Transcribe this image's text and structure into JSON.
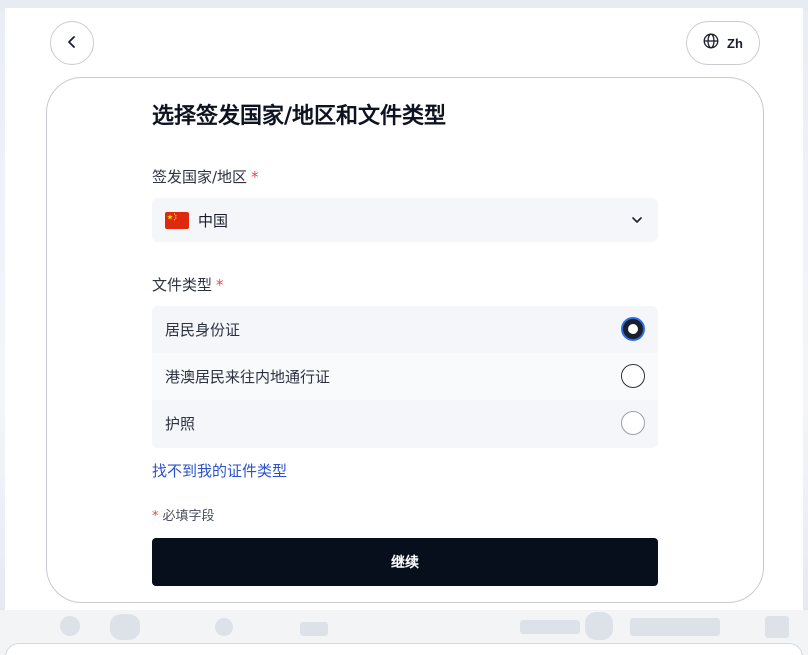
{
  "header": {
    "back_icon": "chevron-left-icon",
    "language": {
      "icon": "globe-icon",
      "label": "Zh"
    }
  },
  "form": {
    "title": "选择签发国家/地区和文件类型",
    "country": {
      "label": "签发国家/地区",
      "required_mark": "*",
      "selected_value": "中国",
      "flag_icon": "china-flag-icon",
      "dropdown_icon": "chevron-down-icon"
    },
    "document_type": {
      "label": "文件类型",
      "required_mark": "*",
      "options": [
        {
          "label": "居民身份证",
          "selected": true
        },
        {
          "label": "港澳居民来往内地通行证",
          "selected": false
        },
        {
          "label": "护照",
          "selected": false
        }
      ]
    },
    "help_link": "找不到我的证件类型",
    "required_note": {
      "mark": "*",
      "text": "必填字段"
    },
    "continue_label": "继续"
  },
  "colors": {
    "accent": "#2a52cc",
    "required": "#e5484d",
    "button_bg": "#070e1c",
    "radio_selected_ring": "#2f6fe4"
  }
}
